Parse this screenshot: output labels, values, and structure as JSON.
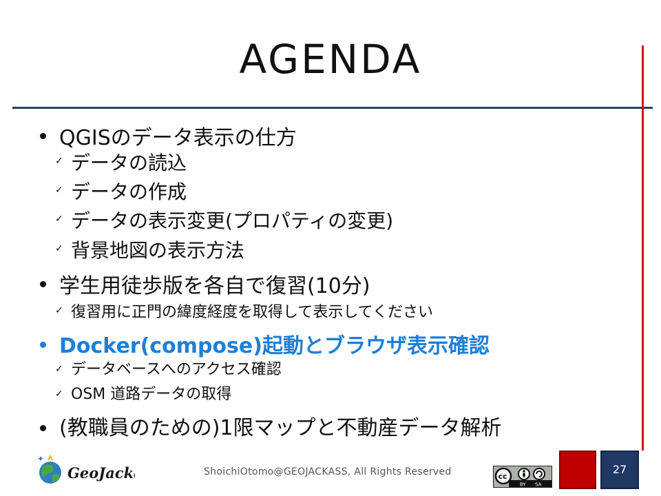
{
  "slide": {
    "title": "AGENDA",
    "page_number": "27",
    "footer": "ShoichiOtomo@GEOJACKASS, All Rights Reserved"
  },
  "logo": {
    "text": "GeoJackass"
  },
  "license": {
    "by": "BY",
    "sa": "SA",
    "cc": "cc"
  },
  "agenda": [
    {
      "level": 1,
      "text": "QGISのデータ表示の仕方"
    },
    {
      "level": 2,
      "text": "データの読込"
    },
    {
      "level": 2,
      "text": "データの作成"
    },
    {
      "level": 2,
      "text": "データの表示変更(プロパティの変更)"
    },
    {
      "level": 2,
      "text": "背景地図の表示方法"
    },
    {
      "level": 1,
      "text": "学生用徒歩版を各自で復習(10分)"
    },
    {
      "level": 2,
      "text": "復習用に正門の緯度経度を取得して表示してください"
    },
    {
      "level": 1,
      "text": "Docker(compose)起動とブラウザ表示確認"
    },
    {
      "level": 2,
      "text": "データベースへのアクセス確認"
    },
    {
      "level": 2,
      "text": "OSM 道路データの取得"
    },
    {
      "level": 1,
      "text": "(教職員のための)1限マップと不動産データ解析"
    }
  ],
  "colors": {
    "highlight": "#1e7fd6",
    "rule_line": "#23425f",
    "side_line": "#d11111"
  }
}
